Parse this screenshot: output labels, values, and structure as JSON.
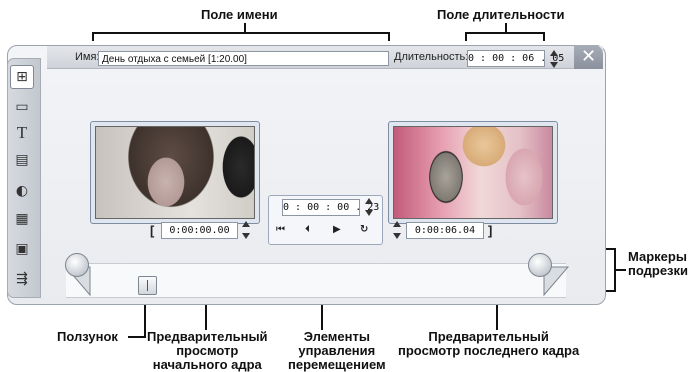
{
  "callouts": {
    "name_field": "Поле имени",
    "duration_field": "Поле длительности",
    "trim_markers": [
      "Маркеры",
      "подрезки"
    ],
    "scrubber": "Ползунок",
    "start_preview": [
      "Предварительный",
      "просмотр",
      "начального адра"
    ],
    "transport": [
      "Элементы",
      "управления",
      "перемещением"
    ],
    "end_preview": [
      "Предварительный",
      "просмотр последнего кадра"
    ]
  },
  "editor": {
    "name_label": "Имя:",
    "name_value": "День отдыха с семьей [1:20.00]",
    "duration_label": "Длительность:",
    "duration_value": "0 : 00 : 06 . 05",
    "close_glyph": "✕"
  },
  "sidebar": {
    "tools": [
      {
        "icon": "video-tool-icon",
        "glyph": "⊞"
      },
      {
        "icon": "image-tool-icon",
        "glyph": "▭"
      },
      {
        "icon": "title-tool-icon",
        "glyph": "T"
      },
      {
        "icon": "disc-menu-tool-icon",
        "glyph": "▤"
      },
      {
        "icon": "sound-tool-icon",
        "glyph": "◐"
      },
      {
        "icon": "clapper-tool-icon",
        "glyph": "▦"
      },
      {
        "icon": "effects-tool-icon",
        "glyph": "▣"
      },
      {
        "icon": "plug-tool-icon",
        "glyph": "⇶"
      }
    ]
  },
  "start_preview": {
    "in_bracket": "[",
    "timecode": "0:00:00.00"
  },
  "end_preview": {
    "out_bracket": "]",
    "timecode": "0:00:06.04"
  },
  "transport": {
    "timecode": "0 : 00 : 00 . 23",
    "buttons": [
      {
        "icon": "go-to-start-icon",
        "glyph": "⏮"
      },
      {
        "icon": "previous-frame-icon",
        "glyph": "⏴"
      },
      {
        "icon": "play-icon",
        "glyph": "▶"
      },
      {
        "icon": "loop-icon",
        "glyph": "↻"
      }
    ]
  }
}
